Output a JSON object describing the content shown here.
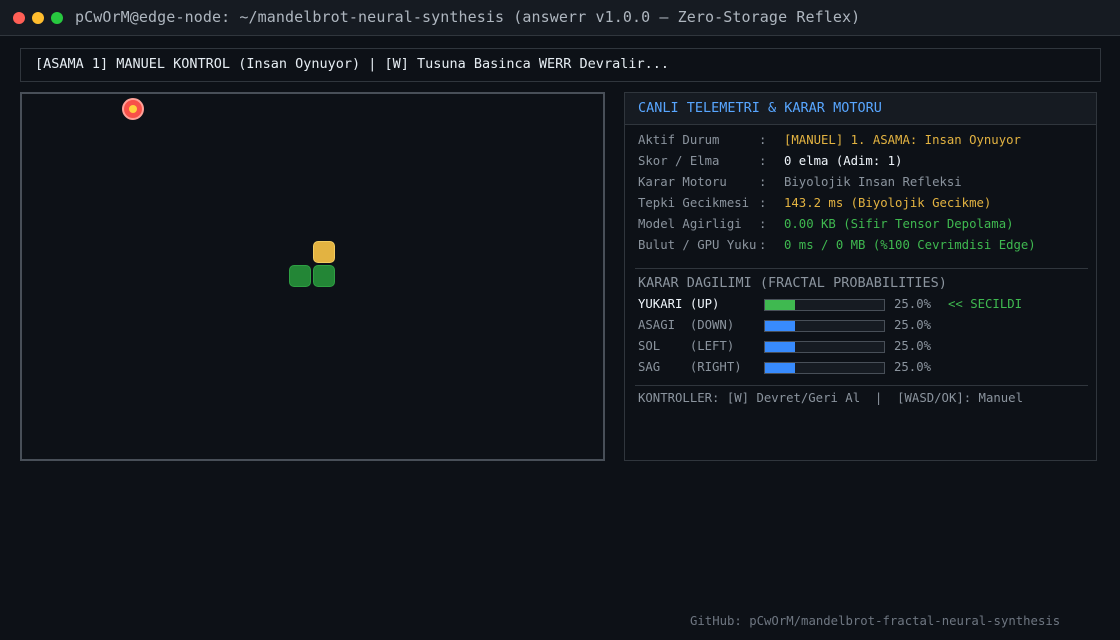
{
  "window": {
    "title": "pCwOrM@edge-node: ~/mandelbrot-neural-synthesis (answerr v1.0.0 — Zero-Storage Reflex)"
  },
  "banner": {
    "text": "[ASAMA 1] MANUEL KONTROL (Insan Oynuyor)  |  [W] Tusuna Basinca WERR Devralir..."
  },
  "game": {
    "apple_icon": "apple-icon",
    "snake_length": 3,
    "colors": {
      "apple": "#f85149",
      "head": "#e3b341",
      "body": "#238636"
    }
  },
  "telemetry": {
    "title": "CANLI TELEMETRI & KARAR MOTORU",
    "rows": [
      {
        "label": "Aktif Durum",
        "value": "[MANUEL] 1. ASAMA: Insan Oynuyor",
        "color": "#e3b341"
      },
      {
        "label": "Skor / Elma",
        "value": "0 elma (Adim: 1)",
        "color": "#f0f6fc"
      },
      {
        "label": "Karar Motoru",
        "value": "Biyolojik Insan Refleksi",
        "color": "#8b949e"
      },
      {
        "label": "Tepki Gecikmesi",
        "value": "143.2 ms (Biyolojik Gecikme)",
        "color": "#e3b341"
      },
      {
        "label": "Model Agirligi",
        "value": "0.00 KB (Sifir Tensor Depolama)",
        "color": "#3fb950"
      },
      {
        "label": "Bulut / GPU Yuku",
        "value": "0 ms / 0 MB (%100 Cevrimdisi Edge)",
        "color": "#3fb950"
      }
    ],
    "separator": ":"
  },
  "decision": {
    "title": "KARAR DAGILIMI (FRACTAL PROBABILITIES)",
    "items": [
      {
        "label": "YUKARI (UP)",
        "percent_text": "25.0%",
        "fraction": 0.25,
        "selected": true,
        "marker": "<< SECILDI"
      },
      {
        "label": "ASAGI  (DOWN)",
        "percent_text": "25.0%",
        "fraction": 0.25,
        "selected": false,
        "marker": ""
      },
      {
        "label": "SOL    (LEFT)",
        "percent_text": "25.0%",
        "fraction": 0.25,
        "selected": false,
        "marker": ""
      },
      {
        "label": "SAG    (RIGHT)",
        "percent_text": "25.0%",
        "fraction": 0.25,
        "selected": false,
        "marker": ""
      }
    ],
    "colors": {
      "selected": "#3fb950",
      "default": "#388bfd"
    }
  },
  "controls": {
    "text": "KONTROLLER: [W] Devret/Geri Al  |  [WASD/OK]: Manuel"
  },
  "footer": {
    "text": "GitHub: pCwOrM/mandelbrot-fractal-neural-synthesis"
  }
}
